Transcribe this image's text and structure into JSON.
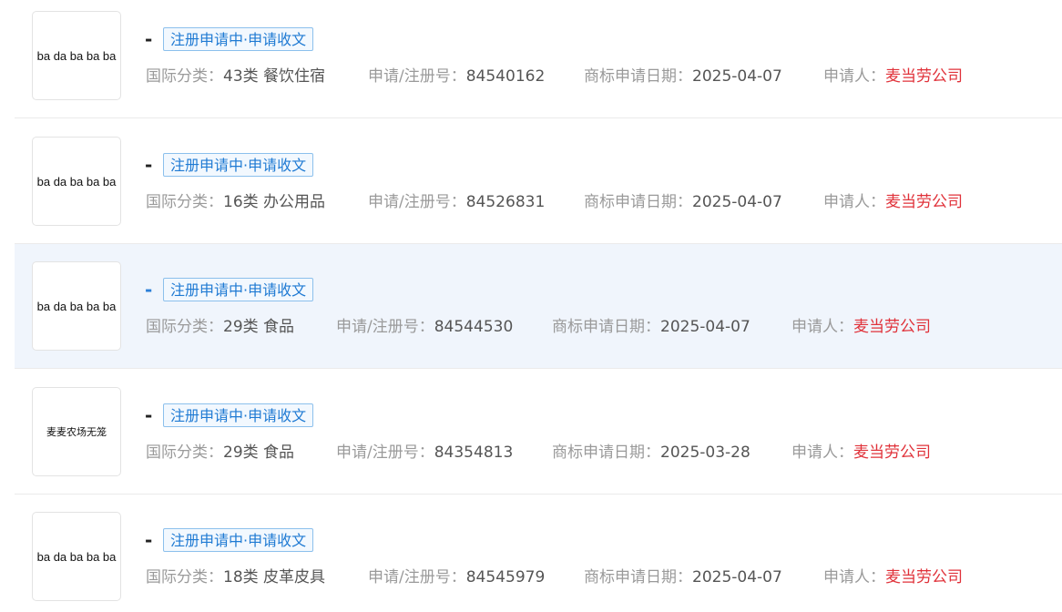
{
  "labels": {
    "class": "国际分类：",
    "reg_no": "申请/注册号：",
    "date": "商标申请日期：",
    "applicant": "申请人："
  },
  "colors": {
    "status_text": "#1f7ad3",
    "applicant_text": "#e0323a",
    "highlight_row": "#f0f5fc"
  },
  "items": [
    {
      "logo_text": "ba da ba ba ba",
      "name": "-",
      "status": "注册申请中·申请收文",
      "class": "43类 餐饮住宿",
      "reg_no": "84540162",
      "date": "2025-04-07",
      "applicant": "麦当劳公司"
    },
    {
      "logo_text": "ba da ba ba ba",
      "name": "-",
      "status": "注册申请中·申请收文",
      "class": "16类 办公用品",
      "reg_no": "84526831",
      "date": "2025-04-07",
      "applicant": "麦当劳公司"
    },
    {
      "logo_text": "ba da ba ba ba",
      "name": "-",
      "status": "注册申请中·申请收文",
      "class": "29类 食品",
      "reg_no": "84544530",
      "date": "2025-04-07",
      "applicant": "麦当劳公司"
    },
    {
      "logo_text": "麦麦农场无笼",
      "name": "-",
      "status": "注册申请中·申请收文",
      "class": "29类 食品",
      "reg_no": "84354813",
      "date": "2025-03-28",
      "applicant": "麦当劳公司"
    },
    {
      "logo_text": "ba da ba ba ba",
      "name": "-",
      "status": "注册申请中·申请收文",
      "class": "18类 皮革皮具",
      "reg_no": "84545979",
      "date": "2025-04-07",
      "applicant": "麦当劳公司"
    }
  ]
}
